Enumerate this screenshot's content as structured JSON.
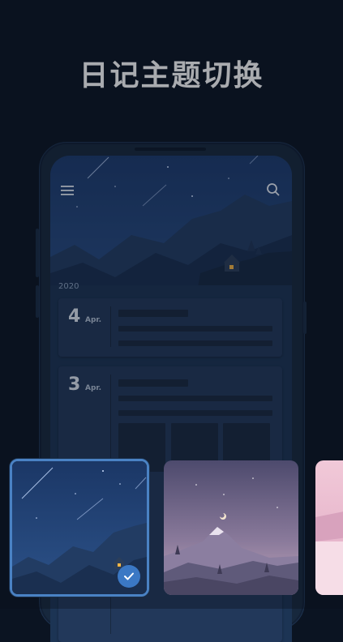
{
  "headline": "日记主题切换",
  "phone": {
    "year": "2020",
    "entries": [
      {
        "day": "4",
        "month": "Apr."
      },
      {
        "day": "3",
        "month": "Apr."
      }
    ],
    "icons": {
      "menu": "menu-icon",
      "search": "search-icon"
    }
  },
  "themes": [
    {
      "name": "night-sky-theme",
      "selected": true,
      "accent": "#3b78c4"
    },
    {
      "name": "dusk-mountain-theme",
      "selected": false,
      "accent": "#9b8ab0"
    },
    {
      "name": "pink-lake-theme",
      "selected": false,
      "accent": "#e7b6cc"
    }
  ],
  "colors": {
    "background": "#0b1422",
    "screen": "#1c3454",
    "card": "#22385a",
    "selection": "#4a82c4"
  }
}
